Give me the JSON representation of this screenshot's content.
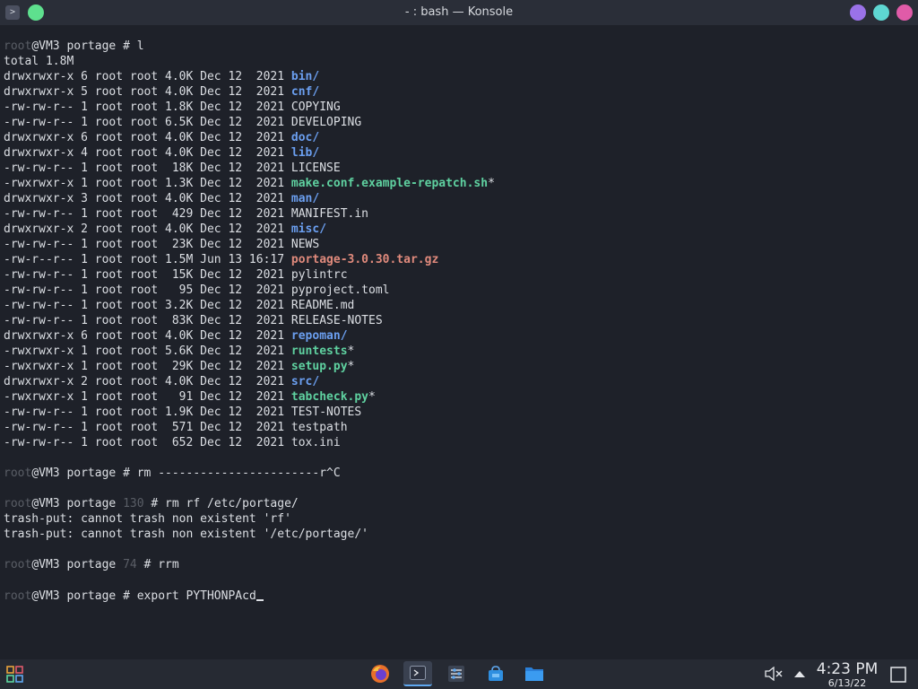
{
  "window": {
    "title": "- : bash — Konsole",
    "app_icon": "terminal-icon",
    "colors": {
      "green_dot": "#5ee08e",
      "purple_dot": "#9a72e8",
      "cyan_dot": "#5ed6d2",
      "pink_dot": "#e05ba8"
    }
  },
  "terminal": {
    "prompt_user": "root",
    "lines": [
      {
        "type": "prompt",
        "host": "@VM3 portage ",
        "code": "",
        "cmd": "# l"
      },
      {
        "type": "text",
        "text": "total 1.8M"
      },
      {
        "type": "file",
        "meta": "drwxrwxr-x 6 root root 4.0K Dec 12  2021 ",
        "name": "bin/",
        "kind": "dir"
      },
      {
        "type": "file",
        "meta": "drwxrwxr-x 5 root root 4.0K Dec 12  2021 ",
        "name": "cnf/",
        "kind": "dir"
      },
      {
        "type": "file",
        "meta": "-rw-rw-r-- 1 root root 1.8K Dec 12  2021 ",
        "name": "COPYING",
        "kind": "plain"
      },
      {
        "type": "file",
        "meta": "-rw-rw-r-- 1 root root 6.5K Dec 12  2021 ",
        "name": "DEVELOPING",
        "kind": "plain"
      },
      {
        "type": "file",
        "meta": "drwxrwxr-x 6 root root 4.0K Dec 12  2021 ",
        "name": "doc/",
        "kind": "dir"
      },
      {
        "type": "file",
        "meta": "drwxrwxr-x 4 root root 4.0K Dec 12  2021 ",
        "name": "lib/",
        "kind": "dir"
      },
      {
        "type": "file",
        "meta": "-rw-rw-r-- 1 root root  18K Dec 12  2021 ",
        "name": "LICENSE",
        "kind": "plain"
      },
      {
        "type": "file",
        "meta": "-rwxrwxr-x 1 root root 1.3K Dec 12  2021 ",
        "name": "make.conf.example-repatch.sh",
        "suffix": "*",
        "kind": "exec"
      },
      {
        "type": "file",
        "meta": "drwxrwxr-x 3 root root 4.0K Dec 12  2021 ",
        "name": "man/",
        "kind": "dir"
      },
      {
        "type": "file",
        "meta": "-rw-rw-r-- 1 root root  429 Dec 12  2021 ",
        "name": "MANIFEST.in",
        "kind": "plain"
      },
      {
        "type": "file",
        "meta": "drwxrwxr-x 2 root root 4.0K Dec 12  2021 ",
        "name": "misc/",
        "kind": "dir"
      },
      {
        "type": "file",
        "meta": "-rw-rw-r-- 1 root root  23K Dec 12  2021 ",
        "name": "NEWS",
        "kind": "plain"
      },
      {
        "type": "file",
        "meta": "-rw-r--r-- 1 root root 1.5M Jun 13 16:17 ",
        "name": "portage-3.0.30.tar.gz",
        "kind": "archive"
      },
      {
        "type": "file",
        "meta": "-rw-rw-r-- 1 root root  15K Dec 12  2021 ",
        "name": "pylintrc",
        "kind": "plain"
      },
      {
        "type": "file",
        "meta": "-rw-rw-r-- 1 root root   95 Dec 12  2021 ",
        "name": "pyproject.toml",
        "kind": "plain"
      },
      {
        "type": "file",
        "meta": "-rw-rw-r-- 1 root root 3.2K Dec 12  2021 ",
        "name": "README.md",
        "kind": "plain"
      },
      {
        "type": "file",
        "meta": "-rw-rw-r-- 1 root root  83K Dec 12  2021 ",
        "name": "RELEASE-NOTES",
        "kind": "plain"
      },
      {
        "type": "file",
        "meta": "drwxrwxr-x 6 root root 4.0K Dec 12  2021 ",
        "name": "repoman/",
        "kind": "dir"
      },
      {
        "type": "file",
        "meta": "-rwxrwxr-x 1 root root 5.6K Dec 12  2021 ",
        "name": "runtests",
        "suffix": "*",
        "kind": "exec"
      },
      {
        "type": "file",
        "meta": "-rwxrwxr-x 1 root root  29K Dec 12  2021 ",
        "name": "setup.py",
        "suffix": "*",
        "kind": "exec"
      },
      {
        "type": "file",
        "meta": "drwxrwxr-x 2 root root 4.0K Dec 12  2021 ",
        "name": "src/",
        "kind": "dir"
      },
      {
        "type": "file",
        "meta": "-rwxrwxr-x 1 root root   91 Dec 12  2021 ",
        "name": "tabcheck.py",
        "suffix": "*",
        "kind": "exec"
      },
      {
        "type": "file",
        "meta": "-rw-rw-r-- 1 root root 1.9K Dec 12  2021 ",
        "name": "TEST-NOTES",
        "kind": "plain"
      },
      {
        "type": "file",
        "meta": "-rw-rw-r-- 1 root root  571 Dec 12  2021 ",
        "name": "testpath",
        "kind": "plain"
      },
      {
        "type": "file",
        "meta": "-rw-rw-r-- 1 root root  652 Dec 12  2021 ",
        "name": "tox.ini",
        "kind": "plain"
      },
      {
        "type": "blank"
      },
      {
        "type": "prompt",
        "host": "@VM3 portage ",
        "code": "",
        "cmd": "# rm -----------------------r^C"
      },
      {
        "type": "blank"
      },
      {
        "type": "prompt",
        "host": "@VM3 portage ",
        "code": "130 ",
        "cmd": "# rm rf /etc/portage/"
      },
      {
        "type": "text",
        "text": "trash-put: cannot trash non existent 'rf'"
      },
      {
        "type": "text",
        "text": "trash-put: cannot trash non existent '/etc/portage/'"
      },
      {
        "type": "blank"
      },
      {
        "type": "prompt",
        "host": "@VM3 portage ",
        "code": "74 ",
        "cmd": "# rrm"
      },
      {
        "type": "blank"
      },
      {
        "type": "prompt",
        "host": "@VM3 portage ",
        "code": "",
        "cmd": "# export PYTHONPAcd",
        "cursor": true
      }
    ]
  },
  "taskbar": {
    "launcher_icon": "app-launcher-icon",
    "apps": [
      {
        "name": "firefox-icon",
        "active": false
      },
      {
        "name": "konsole-icon",
        "active": true
      },
      {
        "name": "system-settings-icon",
        "active": false
      },
      {
        "name": "discover-store-icon",
        "active": false
      },
      {
        "name": "dolphin-files-icon",
        "active": false
      }
    ],
    "tray": {
      "volume_icon": "volume-muted-icon",
      "expand_icon": "tray-expand-icon"
    },
    "clock": {
      "time": "4:23 PM",
      "date": "6/13/22"
    },
    "show_desktop_icon": "show-desktop-icon"
  }
}
